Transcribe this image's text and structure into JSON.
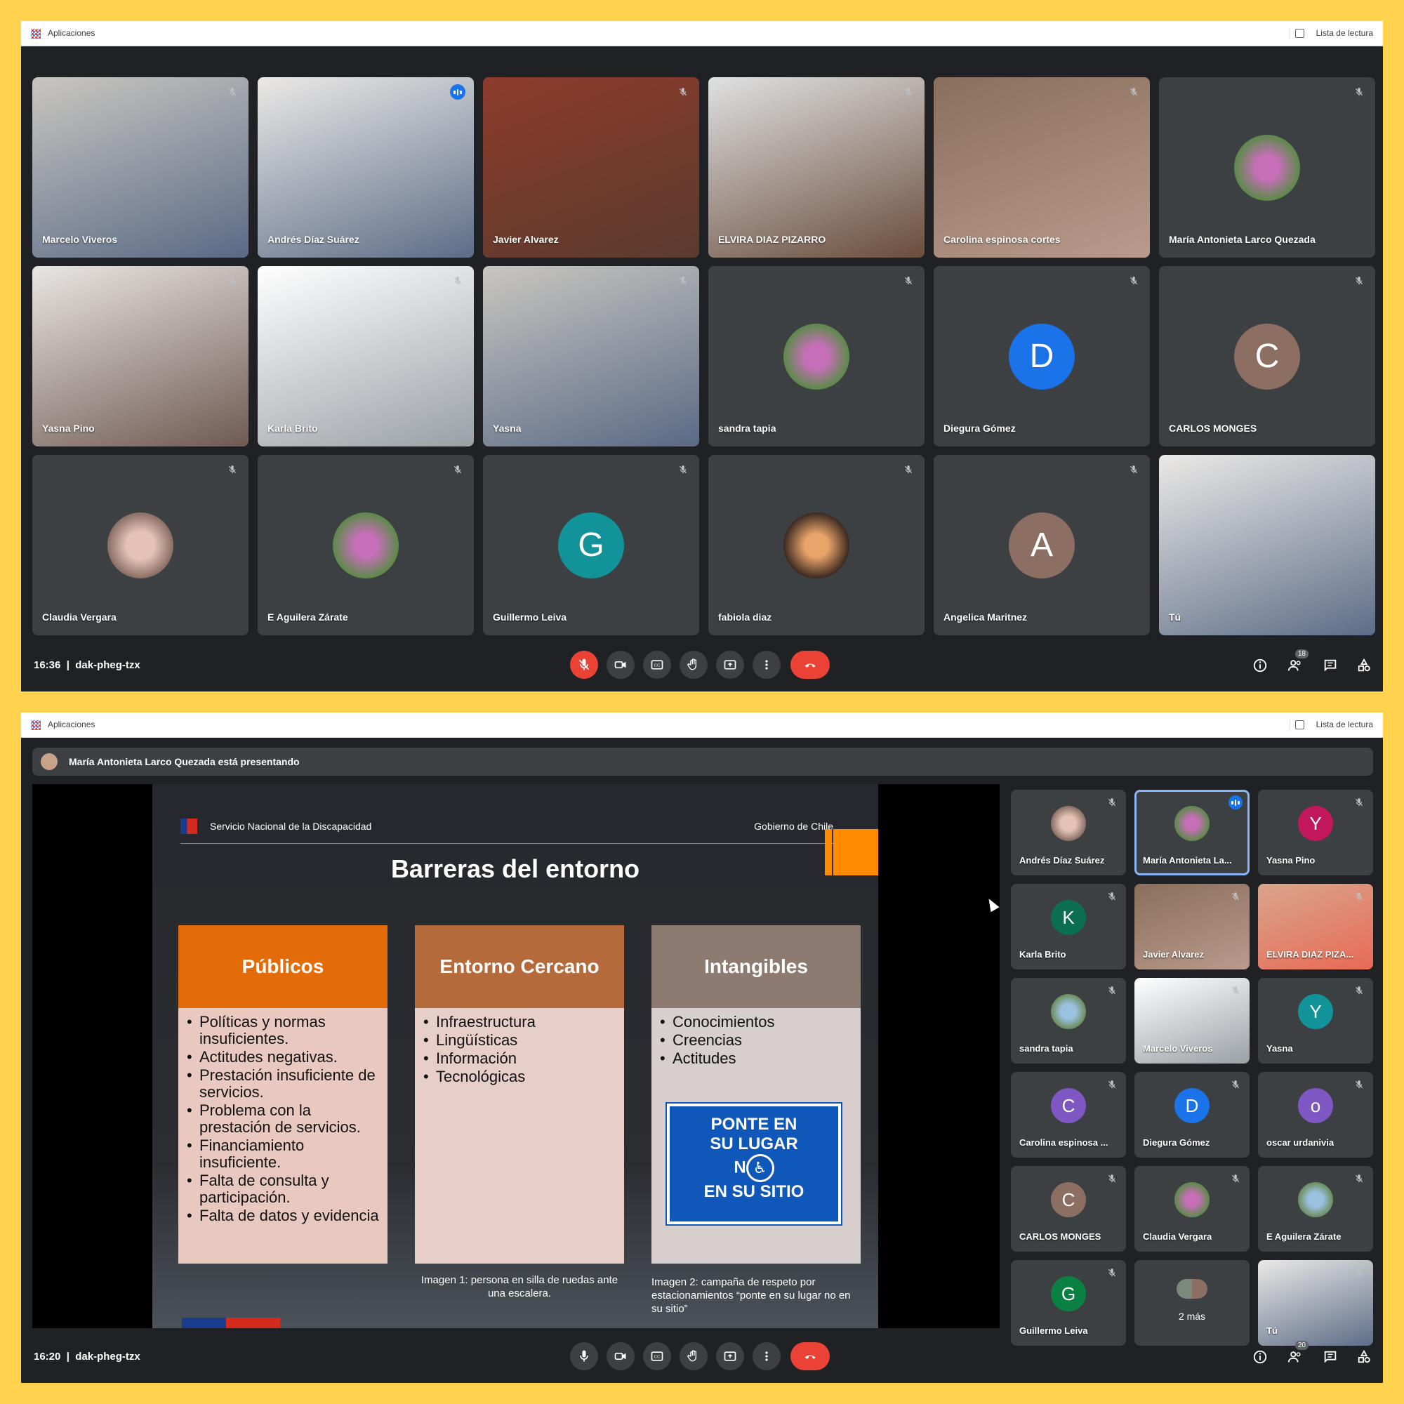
{
  "browser": {
    "apps_label": "Aplicaciones",
    "reading_list_label": "Lista de lectura"
  },
  "colors": {
    "background": "#FFD34E",
    "meet_dark": "#202124",
    "tile": "#3c4043",
    "hangup_red": "#ea4335",
    "active_blue": "#8ab4f8",
    "orange": "#e36c09",
    "orange_brown": "#b46a3a",
    "taupe": "#8d7b72"
  },
  "call1": {
    "time": "16:36",
    "code": "dak-pheg-tzx",
    "participants_count": "18",
    "tiles": [
      {
        "name": "Marcelo Viveros",
        "type": "video"
      },
      {
        "name": "Andrés Díaz Suárez",
        "type": "video",
        "active": true
      },
      {
        "name": "Javier Alvarez",
        "type": "video"
      },
      {
        "name": "ELVIRA DIAZ PIZARRO",
        "type": "video"
      },
      {
        "name": "Carolina espinosa cortes",
        "type": "video"
      },
      {
        "name": "María Antonieta Larco Quezada",
        "type": "photo"
      },
      {
        "name": "Yasna Pino",
        "type": "video"
      },
      {
        "name": "Karla Brito",
        "type": "video"
      },
      {
        "name": "Yasna",
        "type": "video"
      },
      {
        "name": "sandra tapia",
        "type": "photo"
      },
      {
        "name": "Diegura Gómez",
        "type": "letter",
        "letter": "D",
        "color": "#1a73e8"
      },
      {
        "name": "CARLOS MONGES",
        "type": "letter",
        "letter": "C",
        "color": "#8d6e63"
      },
      {
        "name": "Claudia Vergara",
        "type": "photo"
      },
      {
        "name": "E Aguilera Zárate",
        "type": "photo"
      },
      {
        "name": "Guillermo Leiva",
        "type": "letter",
        "letter": "G",
        "color": "#12939a"
      },
      {
        "name": "fabiola diaz",
        "type": "photo"
      },
      {
        "name": "Angelica Maritnez",
        "type": "letter",
        "letter": "A",
        "color": "#8d6e63"
      },
      {
        "name": "Tú",
        "type": "video"
      }
    ]
  },
  "call2": {
    "time": "16:20",
    "code": "dak-pheg-tzx",
    "participants_count": "20",
    "presenting_text": "María Antonieta Larco Quezada está presentando",
    "slide": {
      "org": "Servicio Nacional de la Discapacidad",
      "gov": "Gobierno de Chile",
      "title": "Barreras del entorno",
      "col1": {
        "head": "Públicos",
        "items": [
          "Políticas y normas insuficientes.",
          "Actitudes negativas.",
          "Prestación insuficiente de servicios.",
          "Problema con la prestación de servicios.",
          "Financiamiento insuficiente.",
          "Falta de consulta y participación.",
          "Falta de datos y evidencia"
        ]
      },
      "col2": {
        "head": "Entorno Cercano",
        "items": [
          "Infraestructura",
          "Lingüísticas",
          "Información",
          "Tecnológicas"
        ]
      },
      "col3": {
        "head": "Intangibles",
        "items": [
          "Conocimientos",
          "Creencias",
          "Actitudes"
        ]
      },
      "sign": {
        "line1": "PONTE EN",
        "line2": "SU LUGAR",
        "line3": "N",
        "line4": "EN SU SITIO"
      },
      "caption1": "Imagen 1: persona en silla de ruedas ante una escalera.",
      "caption2": "Imagen 2: campaña de respeto por estacionamientos “ponte en su lugar no en su sitio”"
    },
    "tiles": [
      {
        "name": "Andrés Díaz Suárez",
        "type": "photo"
      },
      {
        "name": "María Antonieta La...",
        "type": "photo",
        "active": true
      },
      {
        "name": "Yasna Pino",
        "type": "letter",
        "letter": "Y",
        "color": "#c2185b"
      },
      {
        "name": "Karla Brito",
        "type": "letter",
        "letter": "K",
        "color": "#0b6e4f"
      },
      {
        "name": "Javier Alvarez",
        "type": "video"
      },
      {
        "name": "ELVIRA DIAZ PIZA...",
        "type": "video"
      },
      {
        "name": "sandra tapia",
        "type": "photo"
      },
      {
        "name": "Marcelo Viveros",
        "type": "video"
      },
      {
        "name": "Yasna",
        "type": "letter",
        "letter": "Y",
        "color": "#12939a"
      },
      {
        "name": "Carolina espinosa ...",
        "type": "letter",
        "letter": "C",
        "color": "#7e57c2"
      },
      {
        "name": "Diegura Gómez",
        "type": "letter",
        "letter": "D",
        "color": "#1a73e8"
      },
      {
        "name": "oscar urdanivia",
        "type": "letter",
        "letter": "o",
        "color": "#7e57c2"
      },
      {
        "name": "CARLOS MONGES",
        "type": "letter",
        "letter": "C",
        "color": "#8d6e63"
      },
      {
        "name": "Claudia Vergara",
        "type": "photo"
      },
      {
        "name": "E Aguilera Zárate",
        "type": "photo"
      },
      {
        "name": "Guillermo Leiva",
        "type": "letter",
        "letter": "G",
        "color": "#0b8043"
      },
      {
        "name": "2 más",
        "type": "more"
      },
      {
        "name": "Tú",
        "type": "video"
      }
    ]
  }
}
